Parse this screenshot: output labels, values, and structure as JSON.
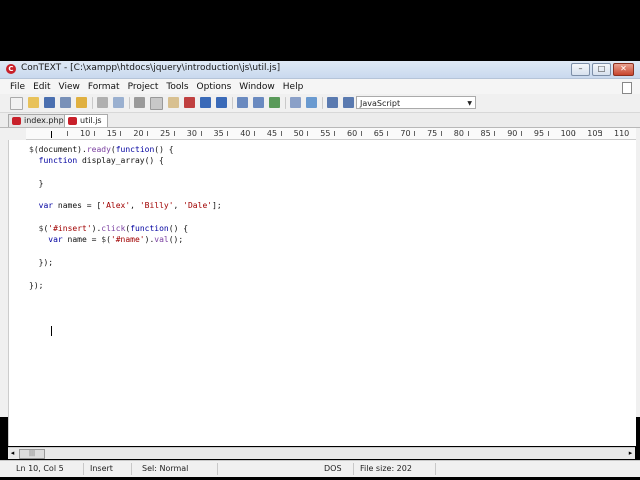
{
  "window": {
    "title": "ConTEXT - [C:\\xampp\\htdocs\\jquery\\introduction\\js\\util.js]",
    "controls": [
      "–",
      "□",
      "✕"
    ]
  },
  "menubar": {
    "items": [
      "File",
      "Edit",
      "View",
      "Format",
      "Project",
      "Tools",
      "Options",
      "Window",
      "Help"
    ]
  },
  "toolbar": {
    "highlighter": "JavaScript"
  },
  "tabs": [
    {
      "label": "index.php"
    },
    {
      "label": "util.js"
    }
  ],
  "ruler": {
    "marks": [
      "10",
      "15",
      "20",
      "25",
      "30",
      "35",
      "40",
      "45",
      "50",
      "55",
      "60",
      "65",
      "70",
      "75",
      "80",
      "85",
      "90",
      "95",
      "100",
      "105",
      "110"
    ]
  },
  "editor": {
    "lines": [
      "$(document).ready(function() {",
      "  function display_array() {",
      "",
      "  }",
      "",
      "  var names = ['Alex', 'Billy', 'Dale'];",
      "",
      "  $('#insert').click(function() {",
      "    var name = $('#name').val();",
      "",
      "  });",
      "",
      "});"
    ]
  },
  "statusbar": {
    "position": "Ln 10, Col 5",
    "mode": "Insert",
    "selection": "Sel: Normal",
    "format": "DOS",
    "filesize": "File size: 202"
  },
  "colors": {
    "keyword": "#0000a0",
    "string": "#a00000",
    "function": "#7a3fa0",
    "app_icon": "#c8202a"
  }
}
